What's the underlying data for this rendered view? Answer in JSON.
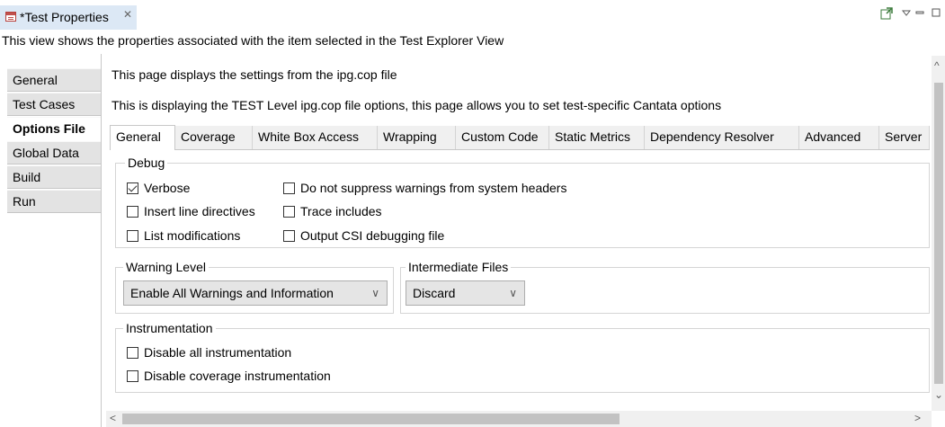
{
  "view": {
    "tab_title": "*Test Properties",
    "close_glyph": "✕",
    "description": "This view shows the properties associated with the item selected in the Test Explorer View"
  },
  "left_tabs": [
    "General",
    "Test Cases",
    "Options File",
    "Global Data",
    "Build",
    "Run"
  ],
  "active_left_tab": "Options File",
  "page": {
    "line1": "This page displays the settings from the ipg.cop file",
    "line2": "This is displaying the TEST Level ipg.cop file options, this page allows you to set test-specific Cantata options"
  },
  "inner_tabs": [
    "General",
    "Coverage",
    "White Box Access",
    "Wrapping",
    "Custom Code",
    "Static Metrics",
    "Dependency Resolver",
    "Advanced",
    "Server"
  ],
  "active_inner_tab": "General",
  "debug": {
    "legend": "Debug",
    "options": [
      {
        "label": "Verbose",
        "checked": true
      },
      {
        "label": "Insert line directives",
        "checked": false
      },
      {
        "label": "List modifications",
        "checked": false
      },
      {
        "label": "Do not suppress warnings from system headers",
        "checked": false
      },
      {
        "label": "Trace includes",
        "checked": false
      },
      {
        "label": "Output CSI debugging file",
        "checked": false
      }
    ]
  },
  "warning_level": {
    "legend": "Warning Level",
    "selected": "Enable All Warnings and Information"
  },
  "intermediate_files": {
    "legend": "Intermediate Files",
    "selected": "Discard"
  },
  "instrumentation": {
    "legend": "Instrumentation",
    "options": [
      {
        "label": "Disable all instrumentation",
        "checked": false
      },
      {
        "label": "Disable coverage instrumentation",
        "checked": false
      }
    ]
  },
  "scrollbar": {
    "up": "^",
    "down": "⌄",
    "left": "<",
    "right": ">"
  },
  "icons": {
    "tab_icon": "properties-icon",
    "toolbar": [
      "pin-view-icon",
      "view-menu-icon",
      "minimize-icon",
      "maximize-icon"
    ]
  }
}
